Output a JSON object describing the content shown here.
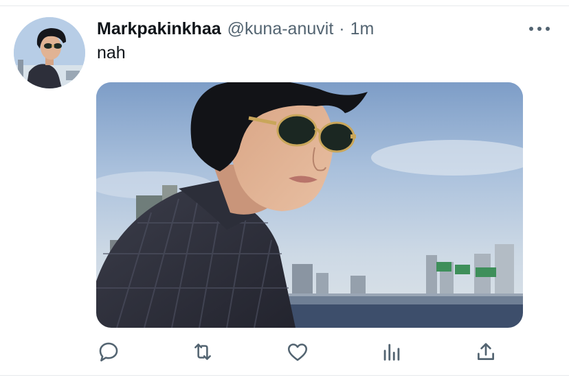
{
  "tweet": {
    "display_name": "Markpakinkhaa",
    "handle": "@kuna-anuvit",
    "separator": "·",
    "time": "1m",
    "text": "nah"
  },
  "icons": {
    "more": "more-horizontal-icon",
    "reply": "reply-bubble-icon",
    "retweet": "retweet-arrows-icon",
    "like": "heart-icon",
    "analytics": "bar-chart-icon",
    "share": "share-upload-icon"
  },
  "colors": {
    "text_primary": "#0f1419",
    "text_secondary": "#536471",
    "divider": "#e6e9ec",
    "background": "#ffffff"
  }
}
